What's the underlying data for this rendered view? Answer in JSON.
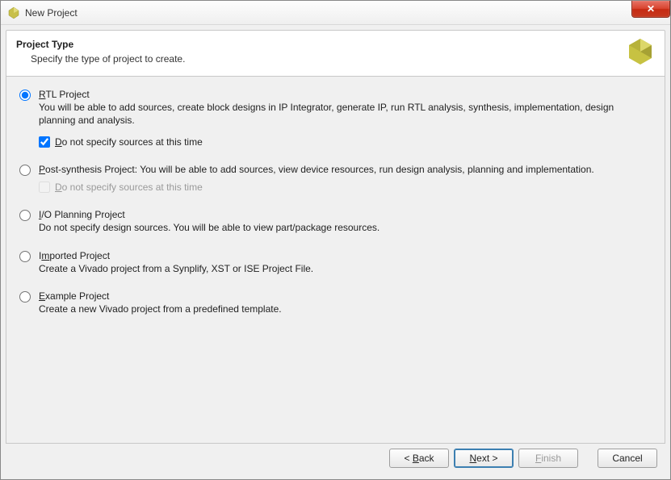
{
  "window": {
    "title": "New Project"
  },
  "header": {
    "title": "Project Type",
    "subtitle": "Specify the type of project to create."
  },
  "options": {
    "rtl": {
      "title": "RTL Project",
      "desc": "You will be able to add sources, create block designs in IP Integrator, generate IP, run RTL analysis, synthesis, implementation, design planning and analysis.",
      "sub_check": "Do not specify sources at this time",
      "sub_checked": true,
      "selected": true
    },
    "postsynth": {
      "title_prefix": "P",
      "title_rest": "ost-synthesis Project: ",
      "desc": "You will be able to add sources, view device resources, run design analysis, planning and implementation.",
      "sub_check": "o not specify sources at this time",
      "sub_prefix": "D",
      "sub_checked": false,
      "selected": false
    },
    "io": {
      "title_prefix": "I",
      "title_rest": "/O Planning Project",
      "desc": "Do not specify design sources. You will be able to view part/package resources.",
      "selected": false
    },
    "imported": {
      "title": "Imported Project",
      "desc": "Create a Vivado project from a Synplify, XST or ISE Project File.",
      "selected": false
    },
    "example": {
      "title": "Example Project",
      "desc": "Create a new Vivado project from a predefined template.",
      "selected": false
    }
  },
  "footer": {
    "back_prefix": "< ",
    "back_u": "B",
    "back_rest": "ack",
    "next_u": "N",
    "next_rest": "ext >",
    "finish_u": "F",
    "finish_rest": "inish",
    "cancel": "Cancel"
  }
}
